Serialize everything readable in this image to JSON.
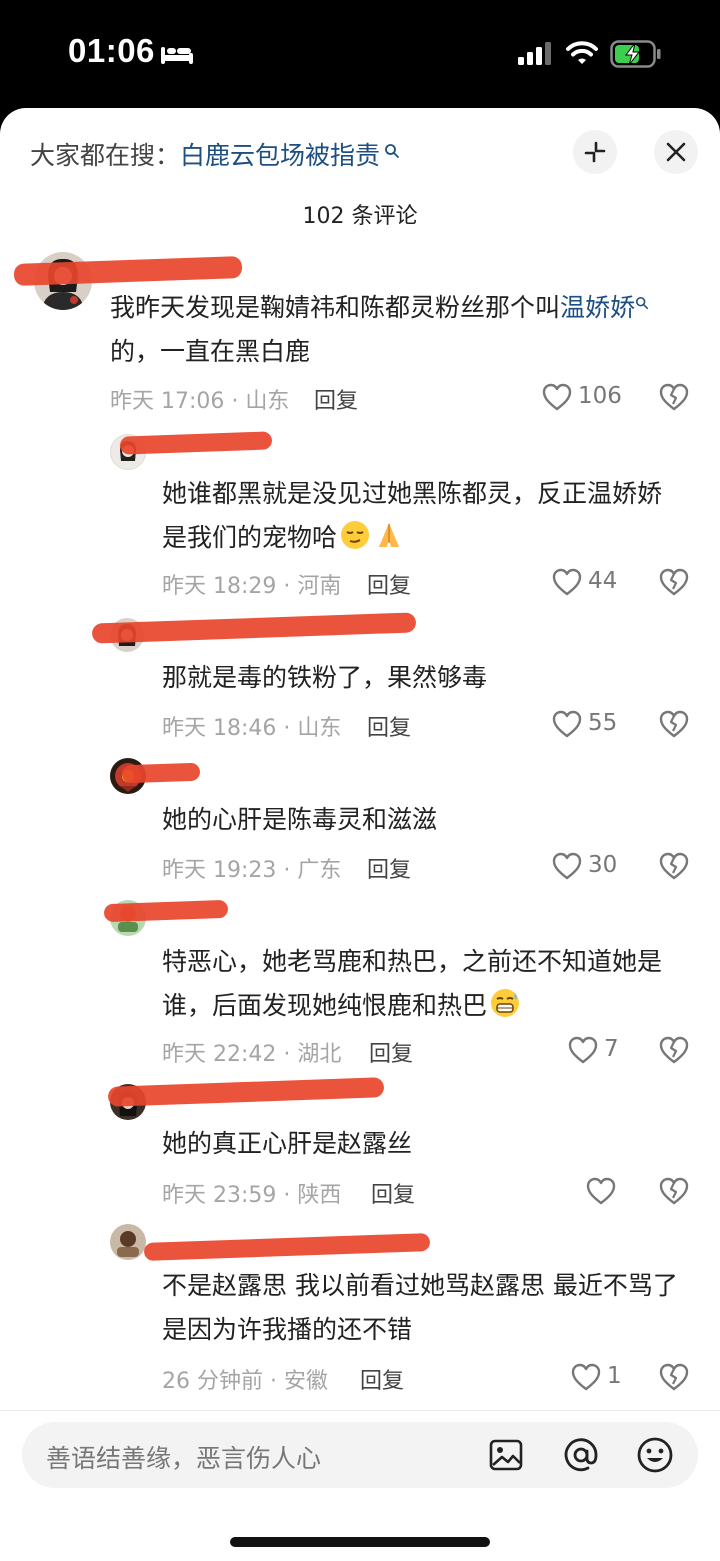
{
  "status": {
    "time": "01:06"
  },
  "search": {
    "prefix": "大家都在搜：",
    "keyword": "白鹿云包场被指责"
  },
  "header": {
    "comment_count": "102 条评论"
  },
  "comments": [
    {
      "text_a": "我昨天发现是鞠婧祎和陈都灵粉丝那个叫",
      "link": "温娇娇",
      "text_b": "的，一直在黑白鹿",
      "meta": "昨天 17:06 · 山东",
      "reply": "回复",
      "likes": "106"
    },
    {
      "text_a": "她谁都黑就是没见过她黑陈都灵，反正温娇娇是我们的宠物哈",
      "meta": "昨天 18:29 · 河南",
      "reply": "回复",
      "likes": "44"
    },
    {
      "text_a": "那就是毒的铁粉了，果然够毒",
      "meta": "昨天 18:46 · 山东",
      "reply": "回复",
      "likes": "55"
    },
    {
      "text_a": "她的心肝是陈毒灵和滋滋",
      "meta": "昨天 19:23 · 广东",
      "reply": "回复",
      "likes": "30"
    },
    {
      "text_a": "特恶心，她老骂鹿和热巴，之前还不知道她是谁，后面发现她纯恨鹿和热巴",
      "meta": "昨天 22:42 · 湖北",
      "reply": "回复",
      "likes": "7"
    },
    {
      "text_a": "她的真正心肝是赵露丝",
      "meta": "昨天 23:59 · 陕西",
      "reply": "回复",
      "likes": ""
    },
    {
      "text_a": "不是赵露思 我以前看过她骂赵露思 最近不骂了是因为许我播的还不错",
      "meta": "26 分钟前 · 安徽",
      "reply": "回复",
      "likes": "1"
    }
  ],
  "input": {
    "placeholder": "善语结善缘，恶言伤人心"
  },
  "icons": {
    "search": "search-icon",
    "collapse": "collapse-icon",
    "close": "close-icon",
    "like": "heart-icon",
    "dislike": "broken-heart-icon",
    "image": "image-icon",
    "mention": "at-icon",
    "emoji": "emoji-icon"
  },
  "colors": {
    "link": "#1d4f80",
    "redaction": "#e8452d"
  }
}
